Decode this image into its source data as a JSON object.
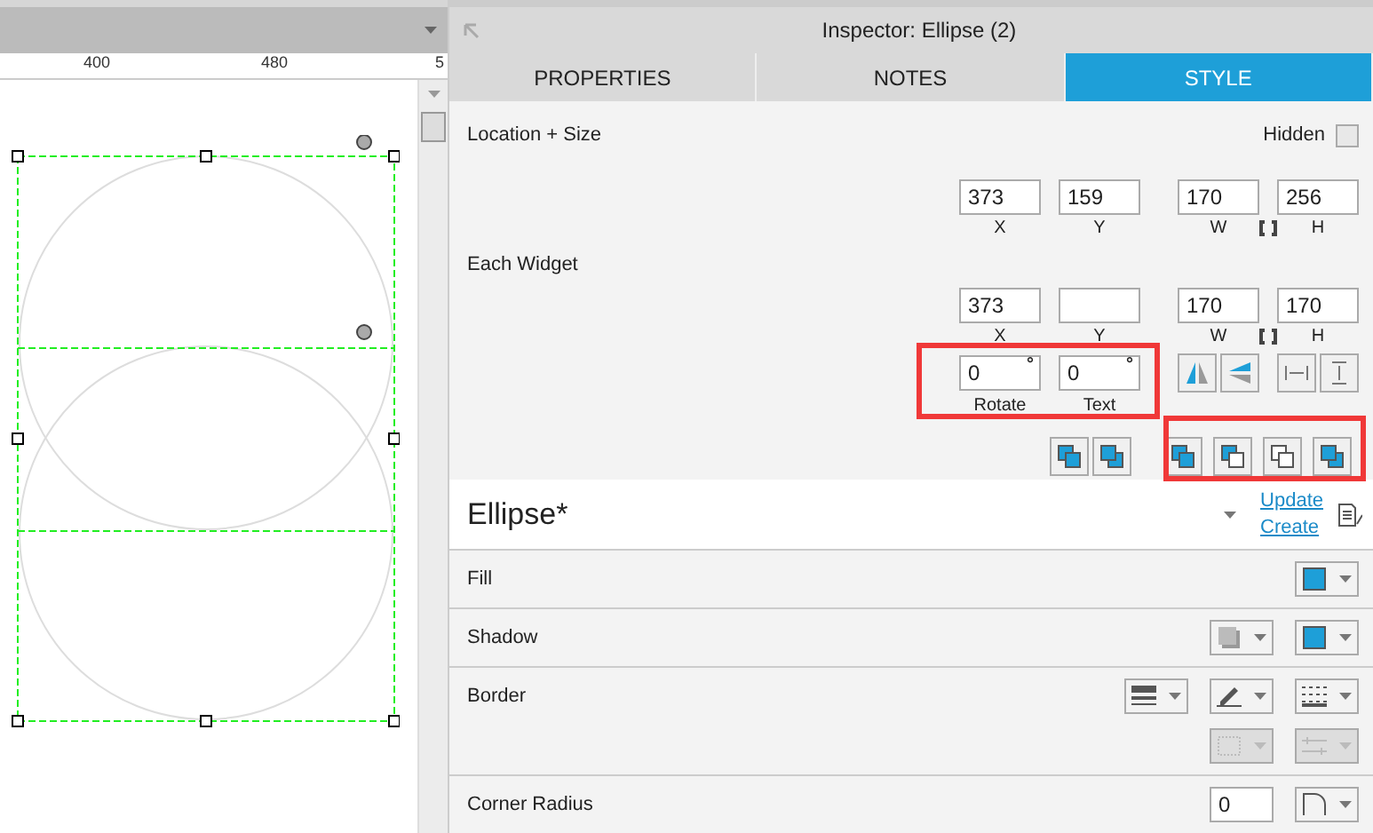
{
  "canvas": {
    "ruler_labels": [
      "400",
      "480",
      "5"
    ]
  },
  "inspector": {
    "title": "Inspector: Ellipse (2)"
  },
  "tabs": [
    {
      "label": "PROPERTIES",
      "selected": false
    },
    {
      "label": "NOTES",
      "selected": false
    },
    {
      "label": "STYLE",
      "selected": true
    }
  ],
  "location_size": {
    "label": "Location + Size",
    "hidden_label": "Hidden",
    "hidden_checked": false,
    "fields": [
      {
        "value": "373",
        "caption": "X"
      },
      {
        "value": "159",
        "caption": "Y"
      },
      {
        "value": "170",
        "caption": "W"
      },
      {
        "value": "256",
        "caption": "H"
      }
    ]
  },
  "each_widget": {
    "label": "Each Widget",
    "fields": [
      {
        "value": "373",
        "caption": "X"
      },
      {
        "caption": "Y"
      },
      {
        "value": "170",
        "caption": "W"
      },
      {
        "value": "170",
        "caption": "H"
      }
    ],
    "rotations": [
      {
        "value": "0",
        "unit": "°",
        "caption": "Rotate"
      },
      {
        "value": "0",
        "unit": "°",
        "caption": "Text"
      }
    ]
  },
  "style": {
    "name": "Ellipse*",
    "links": [
      "Update",
      "Create"
    ]
  },
  "sections": [
    {
      "label": "Fill",
      "controls": [
        {
          "kind": "color",
          "disabled": false
        }
      ]
    },
    {
      "label": "Shadow",
      "controls": [
        {
          "kind": "shadow",
          "disabled": false
        },
        {
          "kind": "color",
          "disabled": false
        }
      ]
    },
    {
      "label": "Border",
      "controls": [
        {
          "kind": "weight",
          "disabled": false
        },
        {
          "kind": "pen",
          "disabled": false
        },
        {
          "kind": "dash",
          "disabled": false
        },
        {
          "kind": "sides",
          "disabled": true
        },
        {
          "kind": "arrows",
          "disabled": true
        }
      ]
    },
    {
      "label": "Corner Radius",
      "value": "0",
      "controls": [
        {
          "kind": "corner",
          "disabled": false
        }
      ]
    }
  ]
}
